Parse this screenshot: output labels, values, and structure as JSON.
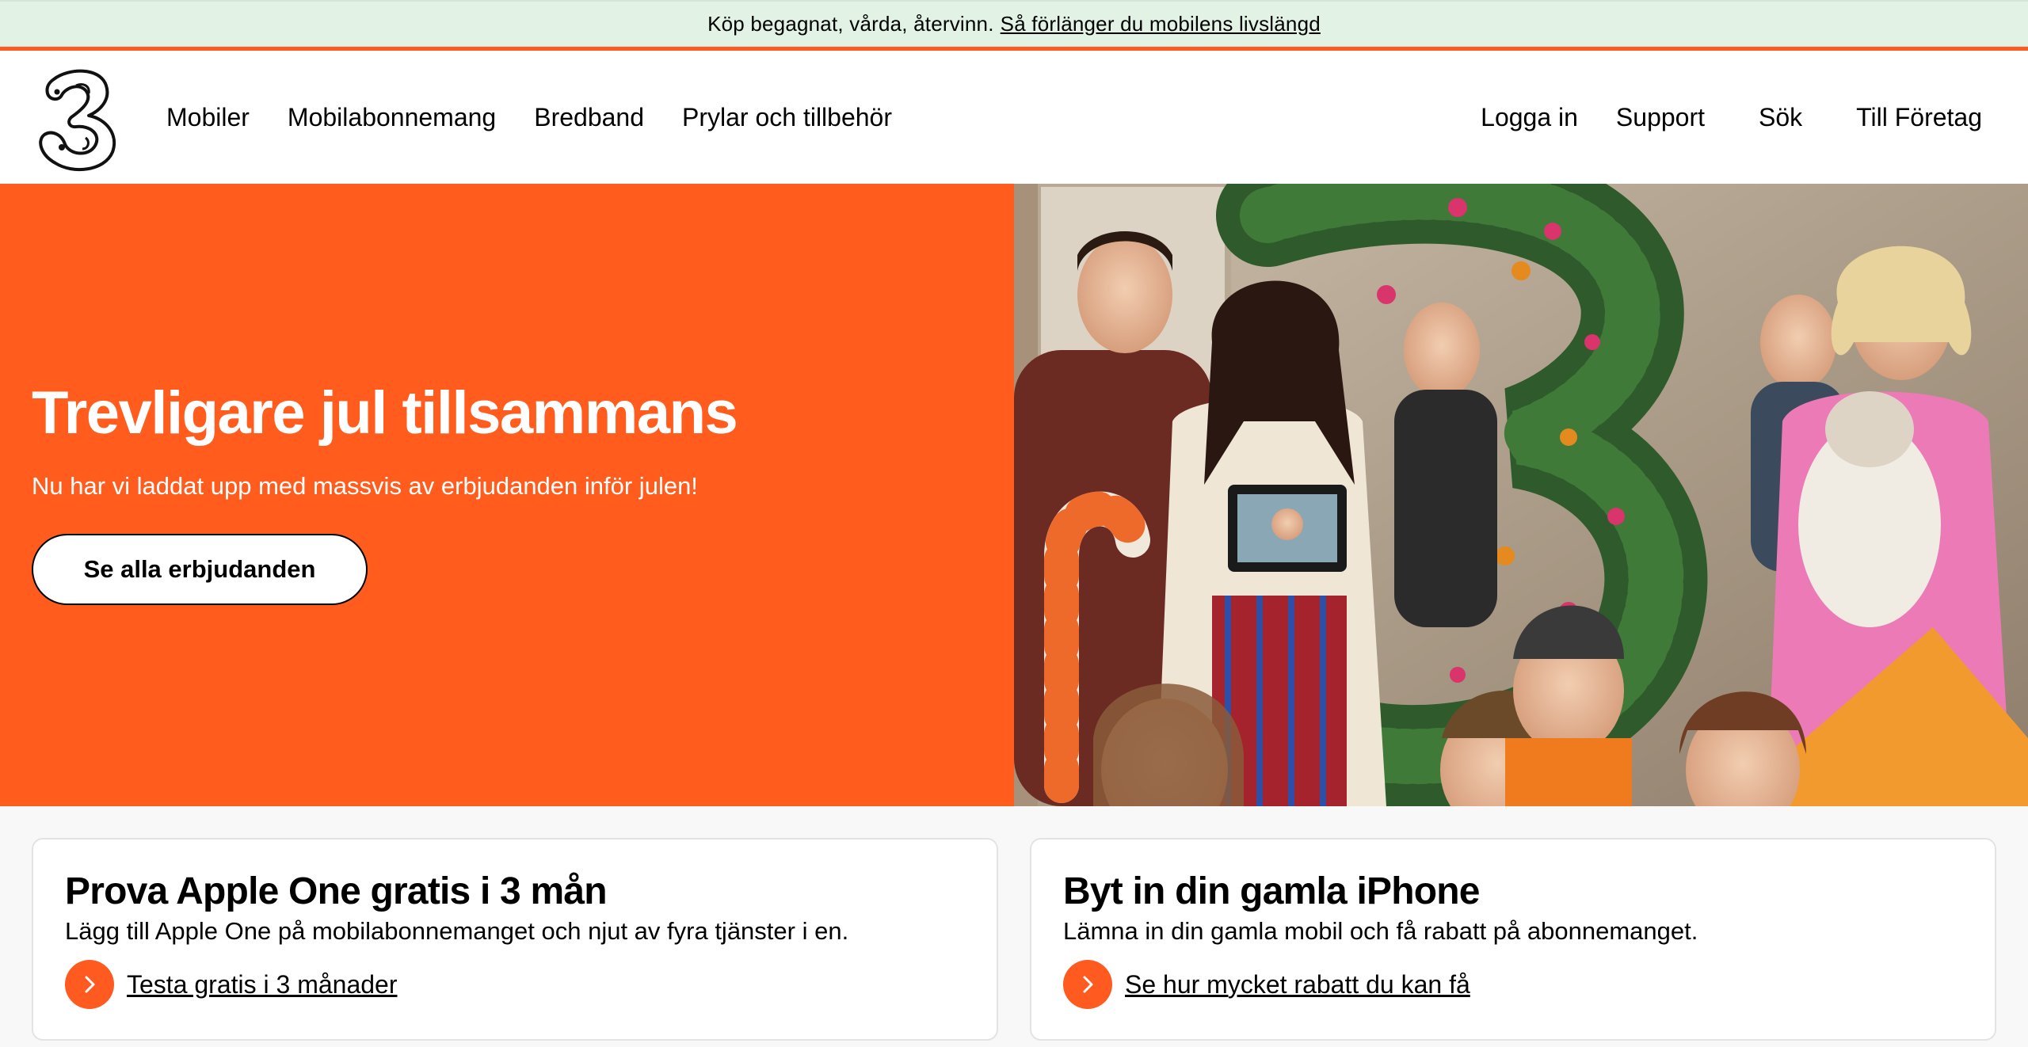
{
  "topbar": {
    "text": "Köp begagnat, vårda, återvinn.",
    "link": "Så förlänger du mobilens livslängd"
  },
  "header": {
    "logo_icon": "three-logo",
    "nav_left": [
      "Mobiler",
      "Mobilabonnemang",
      "Bredband",
      "Prylar och tillbehör"
    ],
    "nav_right": [
      "Logga in",
      "Support",
      "Sök",
      "Till Företag"
    ]
  },
  "hero": {
    "title": "Trevligare jul tillsammans",
    "subtitle": "Nu har vi laddat upp med massvis av erbjudanden inför julen!",
    "button": "Se alla erbjudanden",
    "image_icon": "family-christmas-photo"
  },
  "cards": [
    {
      "title": "Prova Apple One gratis i 3 mån",
      "description": "Lägg till Apple One på mobilabonnemanget och njut av fyra tjänster i en.",
      "link": "Testa gratis i 3 månader",
      "icon": "chevron-right-icon"
    },
    {
      "title": "Byt in din gamla iPhone",
      "description": "Lämna in din gamla mobil och få rabatt på abonnemanget.",
      "link": "Se hur mycket rabatt du kan få",
      "icon": "chevron-right-icon"
    }
  ],
  "colors": {
    "brand_orange": "#ff5c1e",
    "banner_green": "#e2f3e6",
    "white": "#ffffff",
    "black": "#000000"
  }
}
